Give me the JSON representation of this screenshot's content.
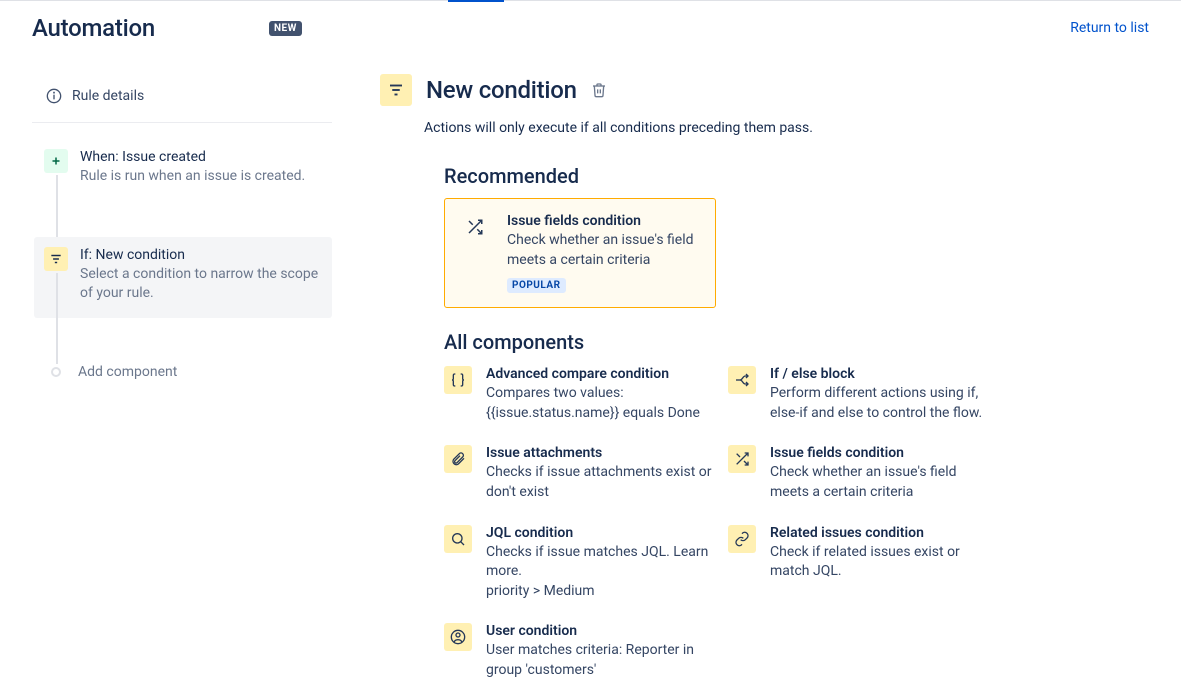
{
  "header": {
    "title": "Automation",
    "badge": "NEW",
    "return_link": "Return to list"
  },
  "sidebar": {
    "rule_details_label": "Rule details",
    "steps": [
      {
        "icon": "plus",
        "color": "green",
        "title": "When: Issue created",
        "desc": "Rule is run when an issue is created.",
        "selected": false
      },
      {
        "icon": "filter",
        "color": "yellow",
        "title": "If: New condition",
        "desc": "Select a condition to narrow the scope of your rule.",
        "selected": true
      }
    ],
    "add_component": "Add component"
  },
  "detail": {
    "icon": "filter",
    "title": "New condition",
    "subtitle": "Actions will only execute if all conditions preceding them pass.",
    "recommended_heading": "Recommended",
    "recommended": {
      "title": "Issue fields condition",
      "desc": "Check whether an issue's field meets a certain criteria",
      "badge": "POPULAR"
    },
    "all_heading": "All components",
    "components": [
      {
        "icon": "braces",
        "title": "Advanced compare condition",
        "desc": "Compares two values: {{issue.status.name}} equals Done"
      },
      {
        "icon": "branch",
        "title": "If / else block",
        "desc": "Perform different actions using if, else-if and else to control the flow."
      },
      {
        "icon": "attachment",
        "title": "Issue attachments",
        "desc": "Checks if issue attachments exist or don't exist"
      },
      {
        "icon": "shuffle",
        "title": "Issue fields condition",
        "desc": "Check whether an issue's field meets a certain criteria"
      },
      {
        "icon": "search",
        "title": "JQL condition",
        "desc": "Checks if issue matches JQL. Learn more.\npriority > Medium"
      },
      {
        "icon": "link",
        "title": "Related issues condition",
        "desc": "Check if related issues exist or match JQL."
      },
      {
        "icon": "user",
        "title": "User condition",
        "desc": "User matches criteria: Reporter in group 'customers'"
      }
    ]
  }
}
